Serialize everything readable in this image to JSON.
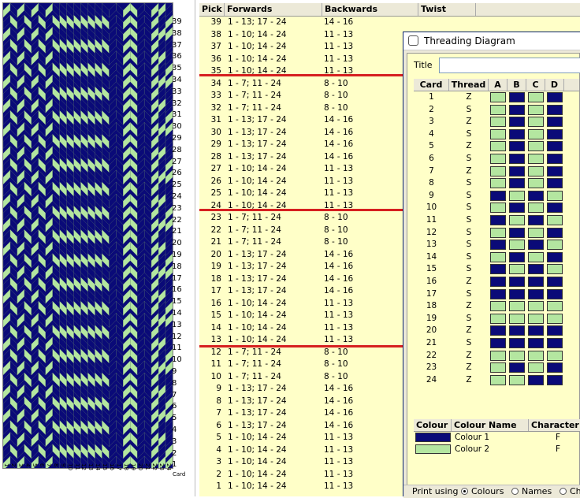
{
  "colors": {
    "navy": "#0a0a78",
    "green": "#b4e6a0",
    "highlight": "#d62020"
  },
  "pattern": {
    "row_numbers": [
      39,
      38,
      37,
      36,
      35,
      34,
      33,
      32,
      31,
      30,
      29,
      28,
      27,
      26,
      25,
      24,
      23,
      22,
      21,
      20,
      19,
      18,
      17,
      16,
      15,
      14,
      13,
      12,
      11,
      10,
      9,
      8,
      7,
      6,
      5,
      4,
      3,
      2,
      1
    ],
    "card_numbers": [
      1,
      2,
      3,
      4,
      5,
      6,
      7,
      8,
      9,
      10,
      11,
      12,
      13,
      14,
      15,
      16,
      17,
      18,
      19,
      20,
      21,
      22,
      23,
      24
    ],
    "card_label": "Card"
  },
  "table": {
    "headers": {
      "pick": "Pick",
      "forwards": "Forwards",
      "backwards": "Backwards",
      "twist": "Twist"
    },
    "rows": [
      {
        "pick": "39",
        "fwd": "1 - 13; 17 - 24",
        "bwd": "14 - 16"
      },
      {
        "pick": "38",
        "fwd": "1 - 10; 14 - 24",
        "bwd": "11 - 13"
      },
      {
        "pick": "37",
        "fwd": "1 - 10; 14 - 24",
        "bwd": "11 - 13"
      },
      {
        "pick": "36",
        "fwd": "1 - 10; 14 - 24",
        "bwd": "11 - 13"
      },
      {
        "pick": "35",
        "fwd": "1 - 10; 14 - 24",
        "bwd": "11 - 13"
      },
      {
        "pick": "34",
        "fwd": "1 - 7; 11 - 24",
        "bwd": "8 - 10"
      },
      {
        "pick": "33",
        "fwd": "1 - 7; 11 - 24",
        "bwd": "8 - 10"
      },
      {
        "pick": "32",
        "fwd": "1 - 7; 11 - 24",
        "bwd": "8 - 10"
      },
      {
        "pick": "31",
        "fwd": "1 - 13; 17 - 24",
        "bwd": "14 - 16"
      },
      {
        "pick": "30",
        "fwd": "1 - 13; 17 - 24",
        "bwd": "14 - 16"
      },
      {
        "pick": "29",
        "fwd": "1 - 13; 17 - 24",
        "bwd": "14 - 16"
      },
      {
        "pick": "28",
        "fwd": "1 - 13; 17 - 24",
        "bwd": "14 - 16"
      },
      {
        "pick": "27",
        "fwd": "1 - 10; 14 - 24",
        "bwd": "11 - 13"
      },
      {
        "pick": "26",
        "fwd": "1 - 10; 14 - 24",
        "bwd": "11 - 13"
      },
      {
        "pick": "25",
        "fwd": "1 - 10; 14 - 24",
        "bwd": "11 - 13"
      },
      {
        "pick": "24",
        "fwd": "1 - 10; 14 - 24",
        "bwd": "11 - 13"
      },
      {
        "pick": "23",
        "fwd": "1 - 7; 11 - 24",
        "bwd": "8 - 10"
      },
      {
        "pick": "22",
        "fwd": "1 - 7; 11 - 24",
        "bwd": "8 - 10"
      },
      {
        "pick": "21",
        "fwd": "1 - 7; 11 - 24",
        "bwd": "8 - 10"
      },
      {
        "pick": "20",
        "fwd": "1 - 13; 17 - 24",
        "bwd": "14 - 16"
      },
      {
        "pick": "19",
        "fwd": "1 - 13; 17 - 24",
        "bwd": "14 - 16"
      },
      {
        "pick": "18",
        "fwd": "1 - 13; 17 - 24",
        "bwd": "14 - 16"
      },
      {
        "pick": "17",
        "fwd": "1 - 13; 17 - 24",
        "bwd": "14 - 16"
      },
      {
        "pick": "16",
        "fwd": "1 - 10; 14 - 24",
        "bwd": "11 - 13"
      },
      {
        "pick": "15",
        "fwd": "1 - 10; 14 - 24",
        "bwd": "11 - 13"
      },
      {
        "pick": "14",
        "fwd": "1 - 10; 14 - 24",
        "bwd": "11 - 13"
      },
      {
        "pick": "13",
        "fwd": "1 - 10; 14 - 24",
        "bwd": "11 - 13"
      },
      {
        "pick": "12",
        "fwd": "1 - 7; 11 - 24",
        "bwd": "8 - 10"
      },
      {
        "pick": "11",
        "fwd": "1 - 7; 11 - 24",
        "bwd": "8 - 10"
      },
      {
        "pick": "10",
        "fwd": "1 - 7; 11 - 24",
        "bwd": "8 - 10"
      },
      {
        "pick": "9",
        "fwd": "1 - 13; 17 - 24",
        "bwd": "14 - 16"
      },
      {
        "pick": "8",
        "fwd": "1 - 13; 17 - 24",
        "bwd": "14 - 16"
      },
      {
        "pick": "7",
        "fwd": "1 - 13; 17 - 24",
        "bwd": "14 - 16"
      },
      {
        "pick": "6",
        "fwd": "1 - 13; 17 - 24",
        "bwd": "14 - 16"
      },
      {
        "pick": "5",
        "fwd": "1 - 10; 14 - 24",
        "bwd": "11 - 13"
      },
      {
        "pick": "4",
        "fwd": "1 - 10; 14 - 24",
        "bwd": "11 - 13"
      },
      {
        "pick": "3",
        "fwd": "1 - 10; 14 - 24",
        "bwd": "11 - 13"
      },
      {
        "pick": "2",
        "fwd": "1 - 10; 14 - 24",
        "bwd": "11 - 13"
      },
      {
        "pick": "1",
        "fwd": "1 - 10; 14 - 24",
        "bwd": "11 - 13"
      }
    ]
  },
  "dialog": {
    "title": "Threading Diagram",
    "title_label": "Title",
    "title_value": "",
    "headers": {
      "card": "Card",
      "thread": "Thread",
      "a": "A",
      "b": "B",
      "c": "C",
      "d": "D"
    },
    "cards": [
      {
        "n": "1",
        "t": "Z",
        "c": "GNGN"
      },
      {
        "n": "2",
        "t": "S",
        "c": "GNGN"
      },
      {
        "n": "3",
        "t": "Z",
        "c": "GNGN"
      },
      {
        "n": "4",
        "t": "S",
        "c": "GNGN"
      },
      {
        "n": "5",
        "t": "Z",
        "c": "GNGN"
      },
      {
        "n": "6",
        "t": "S",
        "c": "GNGN"
      },
      {
        "n": "7",
        "t": "Z",
        "c": "GNGN"
      },
      {
        "n": "8",
        "t": "S",
        "c": "GNGN"
      },
      {
        "n": "9",
        "t": "S",
        "c": "NGNG"
      },
      {
        "n": "10",
        "t": "S",
        "c": "GNGN"
      },
      {
        "n": "11",
        "t": "S",
        "c": "NGNG"
      },
      {
        "n": "12",
        "t": "S",
        "c": "GNGN"
      },
      {
        "n": "13",
        "t": "S",
        "c": "NGNG"
      },
      {
        "n": "14",
        "t": "S",
        "c": "GNGN"
      },
      {
        "n": "15",
        "t": "S",
        "c": "NGNG"
      },
      {
        "n": "16",
        "t": "Z",
        "c": "NNNN"
      },
      {
        "n": "17",
        "t": "S",
        "c": "NNNN"
      },
      {
        "n": "18",
        "t": "Z",
        "c": "GGGG"
      },
      {
        "n": "19",
        "t": "S",
        "c": "GGGG"
      },
      {
        "n": "20",
        "t": "Z",
        "c": "NNNN"
      },
      {
        "n": "21",
        "t": "S",
        "c": "NNNN"
      },
      {
        "n": "22",
        "t": "Z",
        "c": "GGGG"
      },
      {
        "n": "23",
        "t": "Z",
        "c": "GNGN"
      },
      {
        "n": "24",
        "t": "Z",
        "c": "GGNN"
      }
    ],
    "colour_headers": {
      "colour": "Colour",
      "name": "Colour Name",
      "character": "Character"
    },
    "colours": [
      {
        "name": "Colour 1",
        "character": "F",
        "hex": "#0a0a78"
      },
      {
        "name": "Colour 2",
        "character": "F",
        "hex": "#b4e6a0"
      }
    ],
    "print": {
      "label": "Print using",
      "options": [
        "Colours",
        "Names",
        "Ch"
      ],
      "selected": "Colours"
    }
  }
}
